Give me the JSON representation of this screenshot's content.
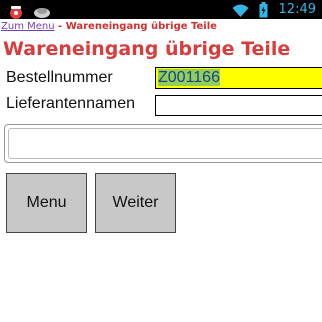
{
  "status_bar": {
    "time": "12:49",
    "icons": [
      "alert-icon",
      "notification-icon",
      "wifi-icon",
      "battery-icon"
    ],
    "accent_color": "#33b5e5"
  },
  "breadcrumb": {
    "link_label": "Zum Menu",
    "separator": " - ",
    "current_label": "Wareneingang übrige Teile"
  },
  "page": {
    "title": "Wareneingang übrige Teile",
    "title_color": "#d83c3c"
  },
  "form": {
    "order_number": {
      "label": "Bestellnummer",
      "value": "Z001166"
    },
    "supplier_name": {
      "label": "Lieferantennamen",
      "value": ""
    },
    "message": ""
  },
  "buttons": {
    "menu_label": "Menu",
    "next_label": "Weiter"
  }
}
